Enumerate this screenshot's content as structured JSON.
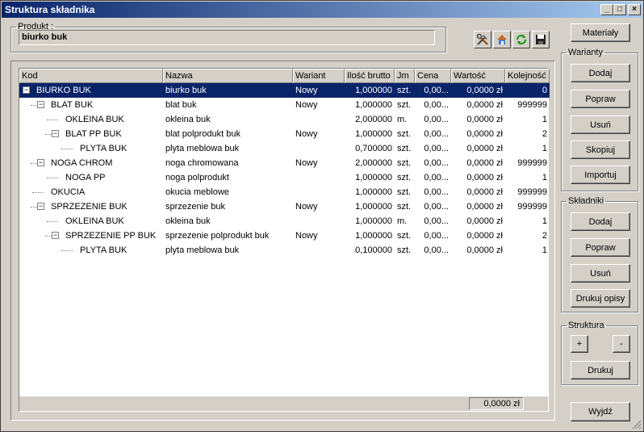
{
  "window": {
    "title": "Struktura składnika"
  },
  "product": {
    "legend": "Produkt :",
    "value": "biurko buk"
  },
  "columns": [
    "Kod",
    "Nazwa",
    "Wariant",
    "Ilość brutto",
    "Jm",
    "Cena",
    "Wartość",
    "Kolejność"
  ],
  "rows": [
    {
      "kod": "BIURKO BUK",
      "nazwa": "biurko buk",
      "wariant": "Nowy",
      "ilosc": "1,000000",
      "jm": "szt.",
      "cena": "0,00...",
      "wartosc": "0,0000 zł",
      "kolejnosc": "0",
      "level": 0,
      "expander": "−"
    },
    {
      "kod": "BLAT BUK",
      "nazwa": "blat buk",
      "wariant": "Nowy",
      "ilosc": "1,000000",
      "jm": "szt.",
      "cena": "0,00...",
      "wartosc": "0,0000 zł",
      "kolejnosc": "999999",
      "level": 1,
      "expander": "−"
    },
    {
      "kod": "OKLEINA BUK",
      "nazwa": "okleina buk",
      "wariant": "",
      "ilosc": "2,000000",
      "jm": "m.",
      "cena": "0,00...",
      "wartosc": "0,0000 zł",
      "kolejnosc": "1",
      "level": 2,
      "expander": ""
    },
    {
      "kod": "BLAT PP BUK",
      "nazwa": "blat polprodukt buk",
      "wariant": "Nowy",
      "ilosc": "1,000000",
      "jm": "szt.",
      "cena": "0,00...",
      "wartosc": "0,0000 zł",
      "kolejnosc": "2",
      "level": 2,
      "expander": "−"
    },
    {
      "kod": "PLYTA BUK",
      "nazwa": "plyta meblowa buk",
      "wariant": "",
      "ilosc": "0,700000",
      "jm": "szt.",
      "cena": "0,00...",
      "wartosc": "0,0000 zł",
      "kolejnosc": "1",
      "level": 3,
      "expander": ""
    },
    {
      "kod": "NOGA CHROM",
      "nazwa": "noga chromowana",
      "wariant": "Nowy",
      "ilosc": "2,000000",
      "jm": "szt.",
      "cena": "0,00...",
      "wartosc": "0,0000 zł",
      "kolejnosc": "999999",
      "level": 1,
      "expander": "−"
    },
    {
      "kod": "NOGA PP",
      "nazwa": "noga polprodukt",
      "wariant": "",
      "ilosc": "1,000000",
      "jm": "szt.",
      "cena": "0,00...",
      "wartosc": "0,0000 zł",
      "kolejnosc": "1",
      "level": 2,
      "expander": ""
    },
    {
      "kod": "OKUCIA",
      "nazwa": "okucia meblowe",
      "wariant": "",
      "ilosc": "1,000000",
      "jm": "szt.",
      "cena": "0,00...",
      "wartosc": "0,0000 zł",
      "kolejnosc": "999999",
      "level": 1,
      "expander": ""
    },
    {
      "kod": "SPRZEZENIE BUK",
      "nazwa": "sprzezenie buk",
      "wariant": "Nowy",
      "ilosc": "1,000000",
      "jm": "szt.",
      "cena": "0,00...",
      "wartosc": "0,0000 zł",
      "kolejnosc": "999999",
      "level": 1,
      "expander": "−"
    },
    {
      "kod": "OKLEINA BUK",
      "nazwa": "okleina buk",
      "wariant": "",
      "ilosc": "1,000000",
      "jm": "m.",
      "cena": "0,00...",
      "wartosc": "0,0000 zł",
      "kolejnosc": "1",
      "level": 2,
      "expander": ""
    },
    {
      "kod": "SPRZEZENIE PP BUK",
      "nazwa": "sprzezenie polprodukt buk",
      "wariant": "Nowy",
      "ilosc": "1,000000",
      "jm": "szt.",
      "cena": "0,00...",
      "wartosc": "0,0000 zł",
      "kolejnosc": "2",
      "level": 2,
      "expander": "−"
    },
    {
      "kod": "PLYTA BUK",
      "nazwa": "plyta meblowa buk",
      "wariant": "",
      "ilosc": "0,100000",
      "jm": "szt.",
      "cena": "0,00...",
      "wartosc": "0,0000 zł",
      "kolejnosc": "1",
      "level": 3,
      "expander": ""
    }
  ],
  "selected_row": 0,
  "total": "0,0000 zł",
  "buttons": {
    "materialy": "Materiały",
    "warianty_legend": "Warianty",
    "warianty_dodaj": "Dodaj",
    "warianty_popraw": "Popraw",
    "warianty_usun": "Usuń",
    "warianty_skopiuj": "Skopiuj",
    "warianty_importuj": "Importuj",
    "skladniki_legend": "Składniki",
    "skladniki_dodaj": "Dodaj",
    "skladniki_popraw": "Popraw",
    "skladniki_usun": "Usuń",
    "skladniki_drukuj_opisy": "Drukuj opisy",
    "struktura_legend": "Struktura",
    "struktura_plus": "+",
    "struktura_minus": "-",
    "struktura_drukuj": "Drukuj",
    "wyjdz": "Wyjdź"
  },
  "toolbar_icons": [
    "tools-icon",
    "home-icon",
    "refresh-icon",
    "save-icon"
  ],
  "colors": {
    "selection": "#0a246a",
    "title_start": "#0a246a",
    "title_end": "#a6caf0",
    "face": "#d4d0c8"
  }
}
